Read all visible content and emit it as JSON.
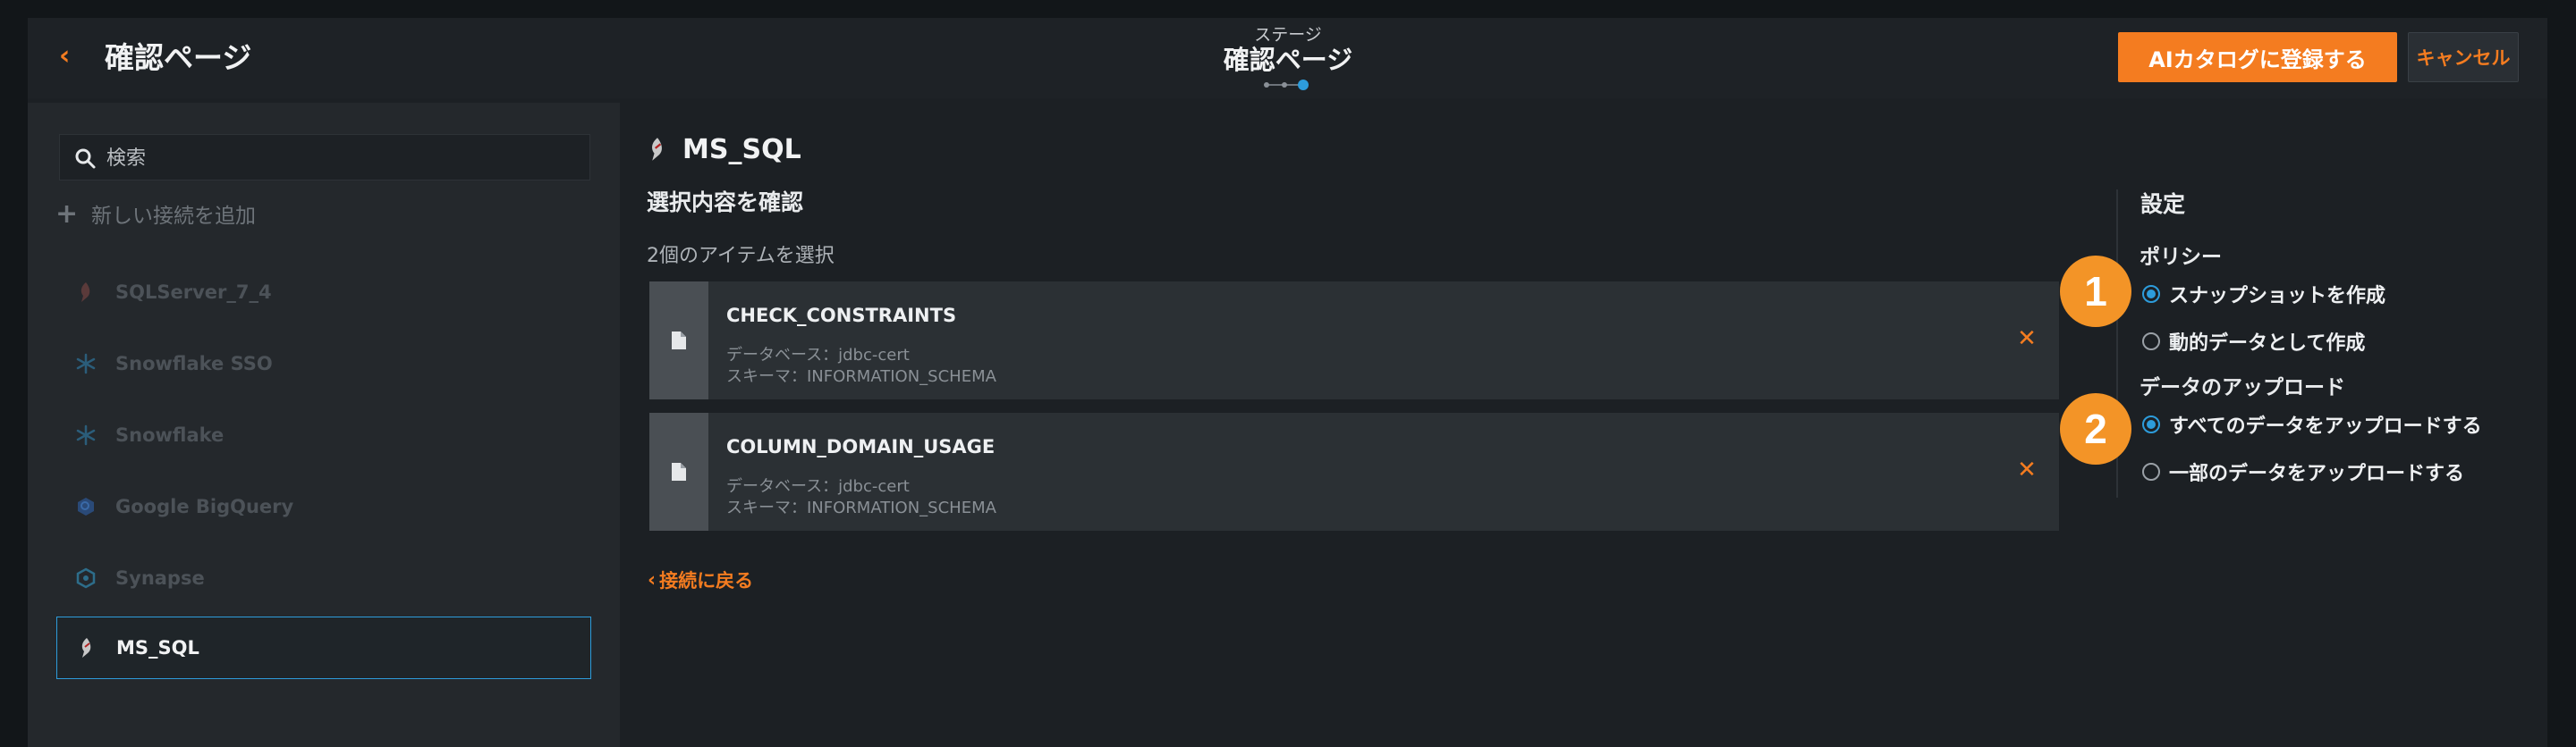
{
  "header": {
    "title": "確認ページ",
    "stage_label": "ステージ",
    "stage_title": "確認ページ",
    "register_label": "AIカタログに登録する",
    "cancel_label": "キャンセル"
  },
  "sidebar": {
    "search_placeholder": "検索",
    "add_connection_label": "新しい接続を追加",
    "connections": [
      {
        "label": "SQLServer_7_4",
        "icon": "sql-server-icon"
      },
      {
        "label": "Snowflake SSO",
        "icon": "snowflake-icon"
      },
      {
        "label": "Snowflake",
        "icon": "snowflake-icon"
      },
      {
        "label": "Google BigQuery",
        "icon": "bigquery-icon"
      },
      {
        "label": "Synapse",
        "icon": "synapse-icon"
      },
      {
        "label": "MS_SQL",
        "icon": "sql-server-icon",
        "selected": true
      }
    ]
  },
  "main": {
    "connection_title": "MS_SQL",
    "review_heading": "選択内容を確認",
    "selected_count": "2個のアイテムを選択",
    "items": [
      {
        "name": "CHECK_CONSTRAINTS",
        "database": "データベース：jdbc-cert",
        "schema": "スキーマ：INFORMATION_SCHEMA"
      },
      {
        "name": "COLUMN_DOMAIN_USAGE",
        "database": "データベース：jdbc-cert",
        "schema": "スキーマ：INFORMATION_SCHEMA"
      }
    ],
    "back_link": "接続に戻る"
  },
  "settings": {
    "heading": "設定",
    "policy_label": "ポリシー",
    "policy_options": [
      {
        "label": "スナップショットを作成",
        "checked": true
      },
      {
        "label": "動的データとして作成",
        "checked": false
      }
    ],
    "upload_label": "データのアップロード",
    "upload_options": [
      {
        "label": "すべてのデータをアップロードする",
        "checked": true
      },
      {
        "label": "一部のデータをアップロードする",
        "checked": false
      }
    ]
  },
  "callouts": [
    "1",
    "2"
  ],
  "colors": {
    "accent": "#f47c20",
    "selection": "#2d9cdb",
    "callout": "#f39427"
  }
}
